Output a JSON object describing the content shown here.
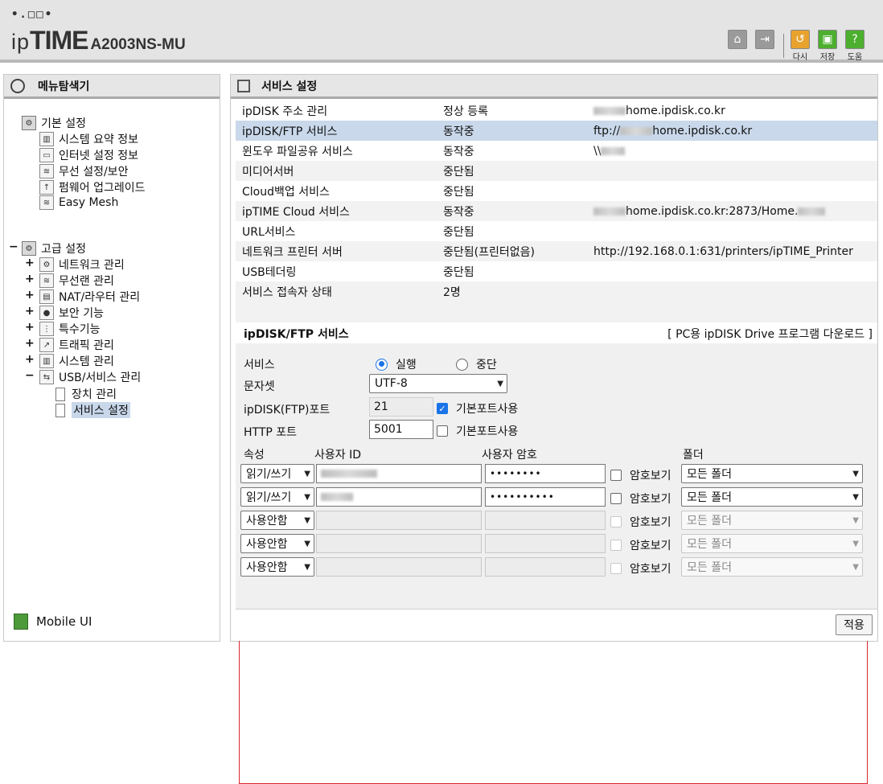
{
  "header": {
    "logo_mark": "•.□□•",
    "brand_ip": "ip",
    "brand_time": "TIME",
    "model": "A2003NS-MU",
    "buttons": {
      "redo": "다시",
      "save": "저장",
      "help": "도움"
    }
  },
  "sidebar": {
    "title": "메뉴탐색기",
    "basic_group": "기본 설정",
    "basic_items": [
      "시스템 요약 정보",
      "인터넷 설정 정보",
      "무선 설정/보안",
      "펌웨어 업그레이드",
      "Easy Mesh"
    ],
    "advanced_group": "고급 설정",
    "advanced_items": [
      "네트워크 관리",
      "무선랜 관리",
      "NAT/라우터 관리",
      "보안 기능",
      "특수기능",
      "트래픽 관리",
      "시스템 관리",
      "USB/서비스 관리"
    ],
    "usb_children": [
      "장치 관리",
      "서비스 설정"
    ],
    "mobile": "Mobile UI"
  },
  "main": {
    "title": "서비스 설정",
    "services": [
      {
        "name": "ipDISK 주소 관리",
        "status": "정상 등록",
        "addr": "home.ipdisk.co.kr"
      },
      {
        "name": "ipDISK/FTP 서비스",
        "status": "동작중",
        "addr": "home.ipdisk.co.kr",
        "prefix": "ftp://"
      },
      {
        "name": "윈도우 파일공유 서비스",
        "status": "동작중",
        "addr": "",
        "prefix": "\\\\"
      },
      {
        "name": "미디어서버",
        "status": "중단됨",
        "addr": ""
      },
      {
        "name": "Cloud백업 서비스",
        "status": "중단됨",
        "addr": ""
      },
      {
        "name": "ipTIME Cloud 서비스",
        "status": "동작중",
        "addr": "home.ipdisk.co.kr:2873/Home."
      },
      {
        "name": "URL서비스",
        "status": "중단됨",
        "addr": ""
      },
      {
        "name": "네트워크 프린터 서버",
        "status": "중단됨(프린터없음)",
        "addr": "http://192.168.0.1:631/printers/ipTIME_Printer"
      },
      {
        "name": "USB테더링",
        "status": "중단됨",
        "addr": ""
      },
      {
        "name": "서비스 접속자 상태",
        "status": "2명",
        "addr": ""
      }
    ],
    "section_title": "ipDISK/FTP 서비스",
    "download_link": "[ PC용 ipDISK Drive 프로그램 다운로드 ]",
    "form": {
      "service_label": "서비스",
      "run_label": "실행",
      "stop_label": "중단",
      "charset_label": "문자셋",
      "charset_value": "UTF-8",
      "ftp_port_label": "ipDISK(FTP)포트",
      "ftp_port_value": "21",
      "http_port_label": "HTTP 포트",
      "http_port_value": "5001",
      "default_port_label": "기본포트사용",
      "col_attr": "속성",
      "col_user": "사용자 ID",
      "col_pass": "사용자 암호",
      "col_folder": "폴더",
      "show_pass_label": "암호보기",
      "rows": [
        {
          "attr": "읽기/쓰기",
          "password": "••••••••",
          "folder": "모든 폴더",
          "enabled": true
        },
        {
          "attr": "읽기/쓰기",
          "password": "••••••••••",
          "folder": "모든 폴더",
          "enabled": true
        },
        {
          "attr": "사용안함",
          "password": "",
          "folder": "모든 폴더",
          "enabled": false
        },
        {
          "attr": "사용안함",
          "password": "",
          "folder": "모든 폴더",
          "enabled": false
        },
        {
          "attr": "사용안함",
          "password": "",
          "folder": "모든 폴더",
          "enabled": false
        }
      ]
    },
    "apply_label": "적용"
  },
  "colors": {
    "highlight_row": "#c9d8ea",
    "red_box": "#d9262e",
    "accent": "#1a73e8"
  }
}
